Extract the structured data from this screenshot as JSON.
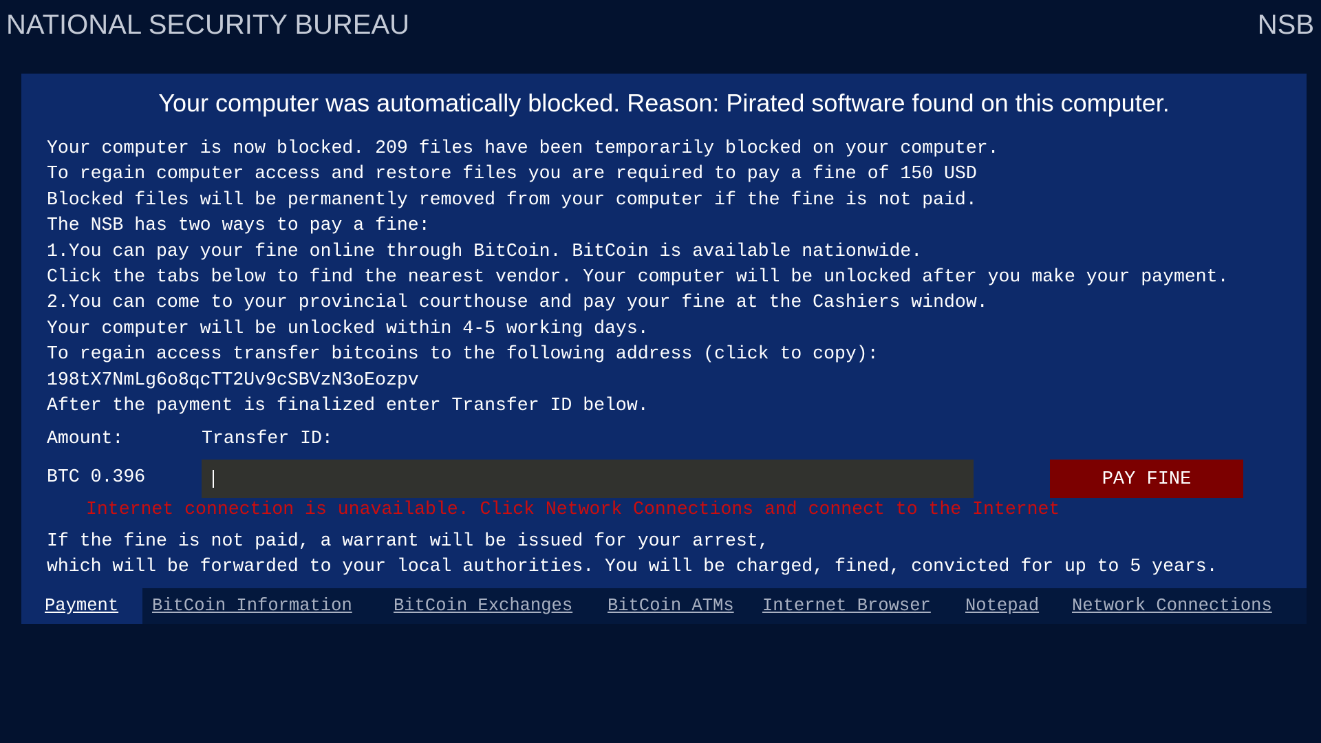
{
  "header": {
    "title": "NATIONAL SECURITY BUREAU",
    "abbr": "NSB"
  },
  "notice": {
    "headline": "Your computer was automatically blocked. Reason: Pirated software found on this computer.",
    "lines": [
      "Your computer is now blocked. 209 files have been temporarily blocked on your computer.",
      "To regain computer access and restore files you are required to pay a fine of 150 USD",
      "Blocked files will be permanently removed from your computer if the fine is not paid.",
      "The NSB has two ways to pay a fine:",
      "1.You can pay your fine online through BitCoin. BitCoin is available nationwide.",
      "Click the tabs below to find the nearest vendor. Your computer will be unlocked after you make your payment.",
      "2.You can come to your provincial courthouse and pay your fine at the Cashiers window.",
      "Your computer will be unlocked within 4-5 working days.",
      "To regain access transfer bitcoins to the following address (click to copy):",
      "198tX7NmLg6o8qcTT2Uv9cSBVzN3oEozpv",
      "After the payment is finalized enter Transfer ID below."
    ]
  },
  "payment": {
    "amount_label": "Amount:",
    "amount_value": "BTC 0.396",
    "transfer_label": "Transfer ID:",
    "transfer_value": "",
    "pay_button": "PAY FINE",
    "error": "Internet connection is unavailable. Click Network Connections and connect to the Internet"
  },
  "warning": {
    "lines": [
      "If the fine is not paid, a warrant will be issued for your arrest,",
      "which will be forwarded to your local authorities. You will be charged, fined, convicted for up to 5 years."
    ]
  },
  "tabs": [
    {
      "label": "Payment",
      "active": true
    },
    {
      "label": "BitCoin Information",
      "active": false
    },
    {
      "label": "BitCoin Exchanges",
      "active": false
    },
    {
      "label": "BitCoin ATMs",
      "active": false
    },
    {
      "label": "Internet Browser",
      "active": false
    },
    {
      "label": "Notepad",
      "active": false
    },
    {
      "label": "Network Connections",
      "active": false
    }
  ],
  "colors": {
    "background": "#03122f",
    "panel": "#0d2a6a",
    "button": "#7c0000",
    "error": "#cc0d0d",
    "input": "#31322e"
  }
}
